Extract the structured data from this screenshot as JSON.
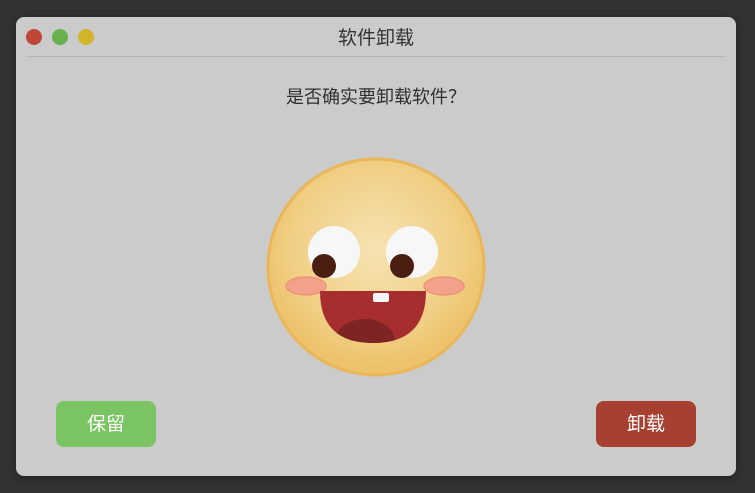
{
  "window": {
    "title": "软件卸载"
  },
  "traffic_lights": {
    "close_color": "#c0463a",
    "minimize_color": "#6ab04c",
    "maximize_color": "#d2b52a"
  },
  "dialog": {
    "question": "是否确实要卸载软件？"
  },
  "face": {
    "icon": "smiling-face-icon",
    "skin_color": "#f1cf85",
    "rim_color": "#e9b659",
    "mouth_color": "#a62e2e",
    "tongue_color": "#7e2424",
    "cheek_color": "#f2a18a",
    "eye_white": "#f7f7f7",
    "pupil_color": "#4a1f12"
  },
  "buttons": {
    "keep_label": "保留",
    "keep_color": "#7bc463",
    "uninstall_label": "卸载",
    "uninstall_color": "#a84032"
  }
}
